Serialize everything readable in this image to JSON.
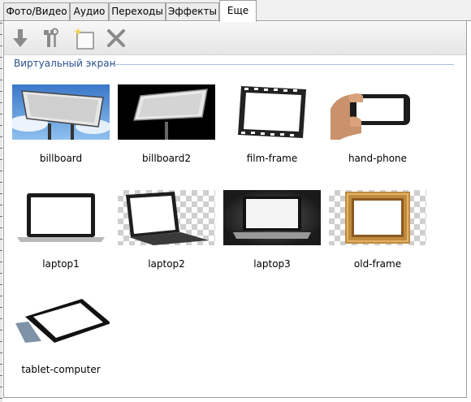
{
  "tabs": [
    {
      "label": "Фото/Видео",
      "active": false
    },
    {
      "label": "Аудио",
      "active": false
    },
    {
      "label": "Переходы",
      "active": false
    },
    {
      "label": "Эффекты",
      "active": false
    },
    {
      "label": "Еще",
      "active": true
    }
  ],
  "toolbar": {
    "icons": [
      "download-arrow-icon",
      "tools-icon",
      "new-item-icon",
      "delete-icon"
    ]
  },
  "group": {
    "title": "Виртуальный экран"
  },
  "items": [
    {
      "label": "billboard"
    },
    {
      "label": "billboard2"
    },
    {
      "label": "film-frame"
    },
    {
      "label": "hand-phone"
    },
    {
      "label": "laptop1"
    },
    {
      "label": "laptop2"
    },
    {
      "label": "laptop3"
    },
    {
      "label": "old-frame"
    },
    {
      "label": "tablet-computer"
    }
  ],
  "colors": {
    "accent": "#2a4f8f",
    "group_line": "#a9bedd",
    "frame": "#c08a3e"
  }
}
